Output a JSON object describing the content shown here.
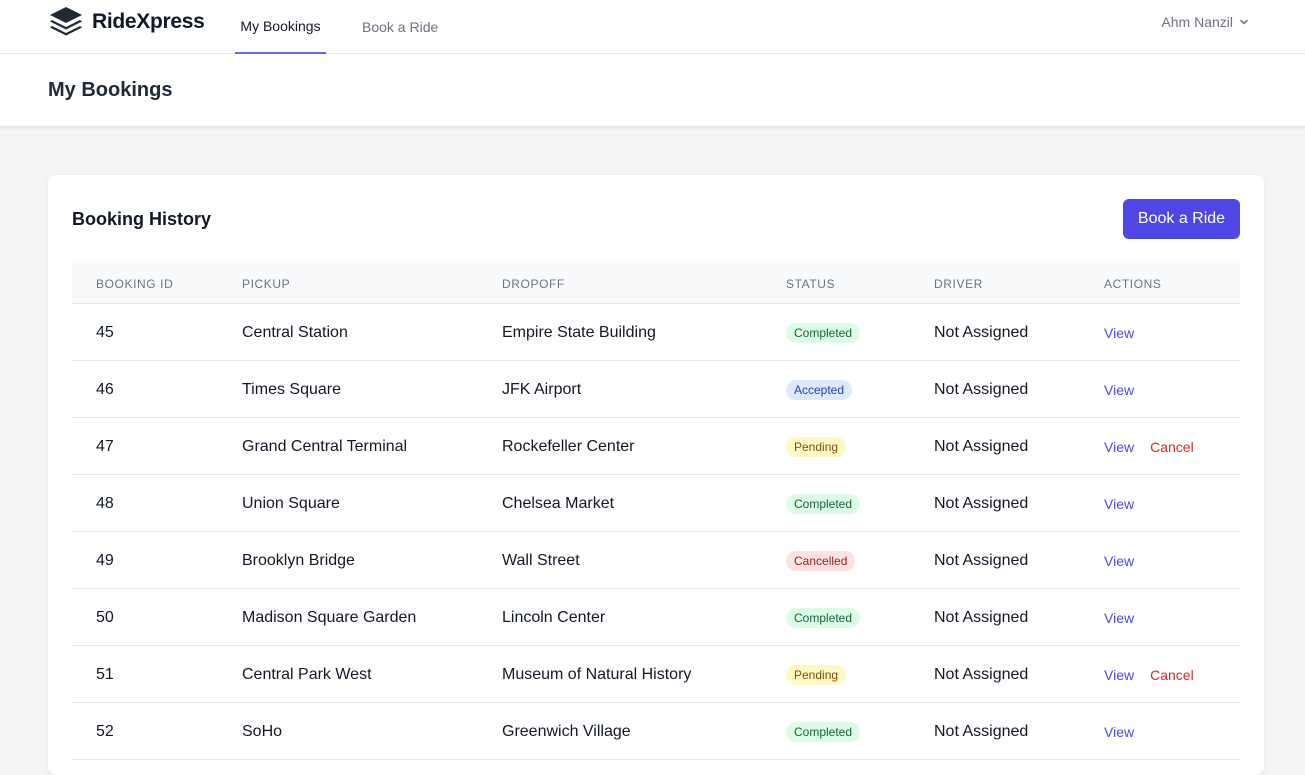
{
  "nav": {
    "brand": "RideXpress",
    "links": [
      "My Bookings",
      "Book a Ride"
    ],
    "user": "Ahm Nanzil"
  },
  "page": {
    "title": "My Bookings"
  },
  "card": {
    "title": "Booking History",
    "button": "Book a Ride"
  },
  "table": {
    "headers": [
      "BOOKING ID",
      "PICKUP",
      "DROPOFF",
      "STATUS",
      "DRIVER",
      "ACTIONS"
    ],
    "rows": [
      {
        "id": "45",
        "pickup": "Central Station",
        "dropoff": "Empire State Building",
        "status": "Completed",
        "driver": "Not Assigned",
        "actions": [
          "View"
        ]
      },
      {
        "id": "46",
        "pickup": "Times Square",
        "dropoff": "JFK Airport",
        "status": "Accepted",
        "driver": "Not Assigned",
        "actions": [
          "View"
        ]
      },
      {
        "id": "47",
        "pickup": "Grand Central Terminal",
        "dropoff": "Rockefeller Center",
        "status": "Pending",
        "driver": "Not Assigned",
        "actions": [
          "View",
          "Cancel"
        ]
      },
      {
        "id": "48",
        "pickup": "Union Square",
        "dropoff": "Chelsea Market",
        "status": "Completed",
        "driver": "Not Assigned",
        "actions": [
          "View"
        ]
      },
      {
        "id": "49",
        "pickup": "Brooklyn Bridge",
        "dropoff": "Wall Street",
        "status": "Cancelled",
        "driver": "Not Assigned",
        "actions": [
          "View"
        ]
      },
      {
        "id": "50",
        "pickup": "Madison Square Garden",
        "dropoff": "Lincoln Center",
        "status": "Completed",
        "driver": "Not Assigned",
        "actions": [
          "View"
        ]
      },
      {
        "id": "51",
        "pickup": "Central Park West",
        "dropoff": "Museum of Natural History",
        "status": "Pending",
        "driver": "Not Assigned",
        "actions": [
          "View",
          "Cancel"
        ]
      },
      {
        "id": "52",
        "pickup": "SoHo",
        "dropoff": "Greenwich Village",
        "status": "Completed",
        "driver": "Not Assigned",
        "actions": [
          "View"
        ]
      }
    ]
  },
  "colors": {
    "accent": "#4f46e5",
    "status": {
      "Completed": {
        "bg": "#dcfce7",
        "fg": "#166534"
      },
      "Accepted": {
        "bg": "#dbeafe",
        "fg": "#1e40af"
      },
      "Pending": {
        "bg": "#fef9c3",
        "fg": "#854d0e"
      },
      "Cancelled": {
        "bg": "#fee2e2",
        "fg": "#991b1b"
      }
    }
  },
  "icons": {
    "brand": "layers-icon",
    "user_menu": "chevron-down-icon"
  }
}
